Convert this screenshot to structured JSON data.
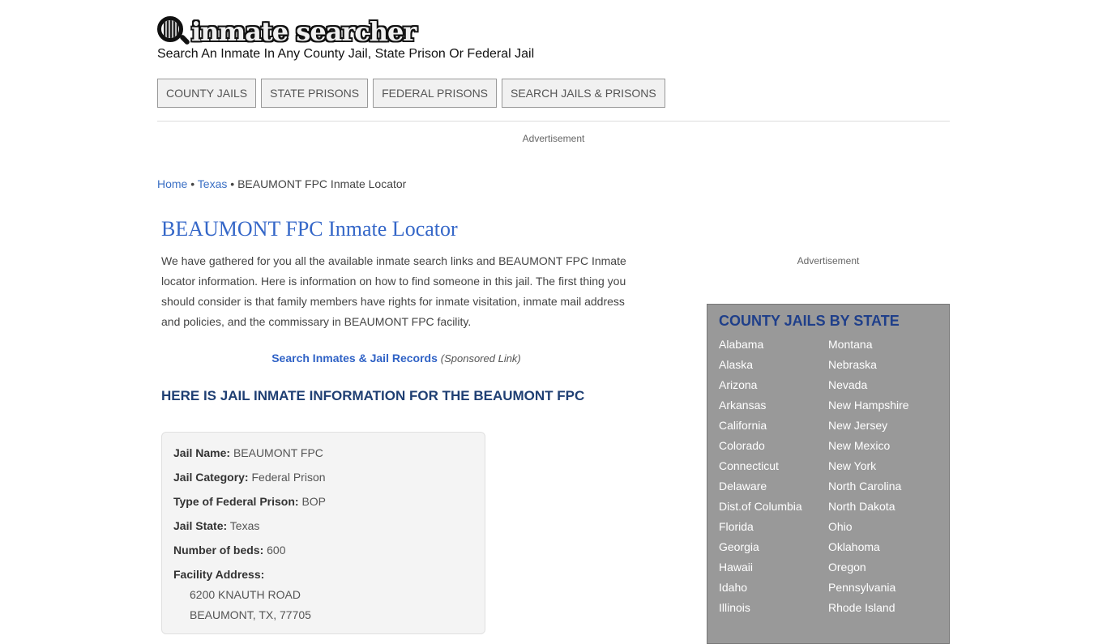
{
  "header": {
    "logo_text": "inmate searcher",
    "tagline": "Search An Inmate In Any County Jail, State Prison Or Federal Jail"
  },
  "nav": [
    {
      "label": "COUNTY JAILS"
    },
    {
      "label": "STATE PRISONS"
    },
    {
      "label": "FEDERAL PRISONS"
    },
    {
      "label": "SEARCH JAILS & PRISONS"
    }
  ],
  "ads": {
    "top_label": "Advertisement",
    "side_label": "Advertisement"
  },
  "breadcrumb": {
    "home": "Home",
    "state": "Texas",
    "separator": "•",
    "current": "BEAUMONT  FPC Inmate Locator"
  },
  "main": {
    "title": "BEAUMONT  FPC Inmate Locator",
    "intro": "We have gathered for you all the available inmate search links and BEAUMONT  FPC Inmate locator information. Here is information on how to find someone in this jail. The first thing you should consider is that family members have rights for inmate visitation, inmate mail address and policies, and the commissary in BEAUMONT  FPC facility.",
    "sponsored_link": "Search Inmates & Jail Records",
    "sponsored_note": "(Sponsored Link)",
    "info_heading": "HERE IS JAIL INMATE INFORMATION FOR THE BEAUMONT  FPC"
  },
  "info": {
    "jail_name_label": "Jail Name:",
    "jail_name": "BEAUMONT  FPC",
    "category_label": "Jail Category:",
    "category": "Federal Prison",
    "type_label": "Type of Federal Prison:",
    "type": "BOP",
    "state_label": "Jail State:",
    "state": "Texas",
    "beds_label": "Number of beds:",
    "beds": "600",
    "address_label": "Facility Address:",
    "address_line1": "6200 KNAUTH ROAD",
    "address_line2": "BEAUMONT, TX, 77705"
  },
  "sidebar": {
    "title": "COUNTY JAILS BY STATE",
    "states": [
      "Alabama",
      "Alaska",
      "Arizona",
      "Arkansas",
      "California",
      "Colorado",
      "Connecticut",
      "Delaware",
      "Dist.of Columbia",
      "Florida",
      "Georgia",
      "Hawaii",
      "Idaho",
      "Illinois",
      "Montana",
      "Nebraska",
      "Nevada",
      "New Hampshire",
      "New Jersey",
      "New Mexico",
      "New York",
      "North Carolina",
      "North Dakota",
      "Ohio",
      "Oklahoma",
      "Oregon",
      "Pennsylvania",
      "Rhode Island"
    ]
  },
  "colors": {
    "link": "#3a6fc4",
    "title": "#3567c8",
    "heading": "#1f3f73",
    "sidebar_bg": "#999999",
    "sidebar_title": "#1f3f8a"
  }
}
